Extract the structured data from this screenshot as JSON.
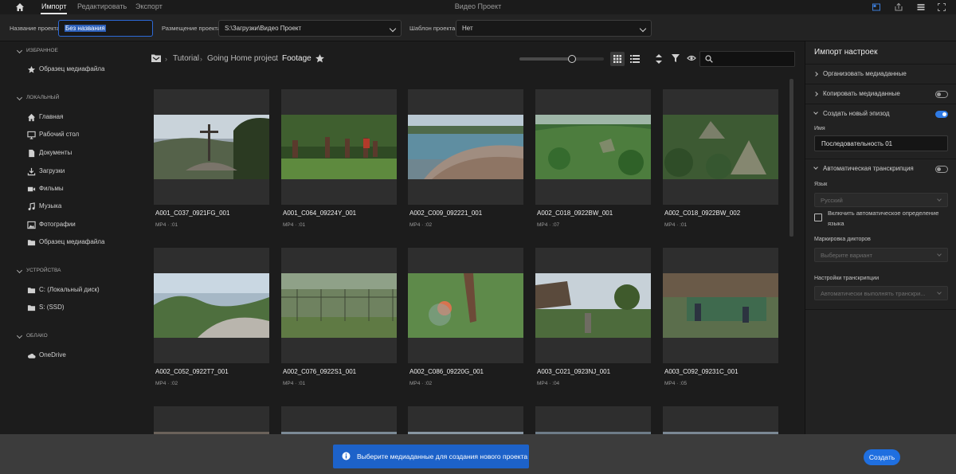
{
  "topbar": {
    "tabs": [
      "Импорт",
      "Редактировать",
      "Экспорт"
    ],
    "title": "Видео Проект"
  },
  "project": {
    "name_label": "Название проекта",
    "name_value": "Без названия",
    "location_label": "Размещение проекта",
    "location_value": "S:\\Загрузки\\Видео Проект",
    "template_label": "Шаблон проекта",
    "template_value": "Нет"
  },
  "sidebar": {
    "favorites_title": "ИЗБРАННОЕ",
    "favorites": [
      {
        "label": "Образец медиафайла",
        "icon": "star-icon"
      }
    ],
    "local_title": "ЛОКАЛЬНЫЙ",
    "local": [
      {
        "label": "Главная",
        "icon": "home-icon"
      },
      {
        "label": "Рабочий стол",
        "icon": "monitor-icon"
      },
      {
        "label": "Документы",
        "icon": "document-icon"
      },
      {
        "label": "Загрузки",
        "icon": "download-icon"
      },
      {
        "label": "Фильмы",
        "icon": "video-camera-icon"
      },
      {
        "label": "Музыка",
        "icon": "music-icon"
      },
      {
        "label": "Фотографии",
        "icon": "image-icon"
      },
      {
        "label": "Образец медиафайла",
        "icon": "folder-icon"
      }
    ],
    "devices_title": "УСТРОЙСТВА",
    "devices": [
      {
        "label": "C: (Локальный диск)",
        "icon": "folder-icon"
      },
      {
        "label": "S: (SSD)",
        "icon": "folder-icon"
      }
    ],
    "cloud_title": "ОБЛАКО",
    "cloud": [
      {
        "label": "OneDrive",
        "icon": "cloud-icon"
      }
    ]
  },
  "breadcrumb": [
    "Tutorial",
    "Going Home project",
    "Footage"
  ],
  "media": [
    {
      "name": "A001_C037_0921FG_001",
      "meta": "MP4 · :01"
    },
    {
      "name": "A001_C064_09224Y_001",
      "meta": "MP4 · :01"
    },
    {
      "name": "A002_C009_092221_001",
      "meta": "MP4 · :02"
    },
    {
      "name": "A002_C018_0922BW_001",
      "meta": "MP4 · :07"
    },
    {
      "name": "A002_C018_0922BW_002",
      "meta": "MP4 · :01"
    },
    {
      "name": "A002_C052_0922T7_001",
      "meta": "MP4 · :02"
    },
    {
      "name": "A002_C076_0922S1_001",
      "meta": "MP4 · :01"
    },
    {
      "name": "A002_C086_09220G_001",
      "meta": "MP4 · :02"
    },
    {
      "name": "A003_C021_0923NJ_001",
      "meta": "MP4 · :04"
    },
    {
      "name": "A003_C092_09231C_001",
      "meta": "MP4 · :05"
    }
  ],
  "panel": {
    "title": "Импорт настроек",
    "organize": "Организовать медиаданные",
    "copy": "Копировать медиаданные",
    "new_sequence": "Создать новый эпизод",
    "name_label": "Имя",
    "name_value": "Последовательность 01",
    "transcription": "Автоматическая транскрипция",
    "language_label": "Язык",
    "language_value": "Русский",
    "auto_detect_line1": "Включить автоматическое определение",
    "auto_detect_line2": "языка",
    "speakers_label": "Маркировка дикторов",
    "speakers_value": "Выберите вариант",
    "settings_label": "Настройки транскрипции",
    "settings_value": "Автоматически выполнять транскри..."
  },
  "bottom": {
    "notice": "Выберите медиаданные для создания нового проекта",
    "create": "Создать"
  },
  "colors": {
    "accent": "#1f6fe0",
    "notice_bg": "#1d62c9",
    "panel_bg": "#222222",
    "bg": "#1c1c1c"
  }
}
